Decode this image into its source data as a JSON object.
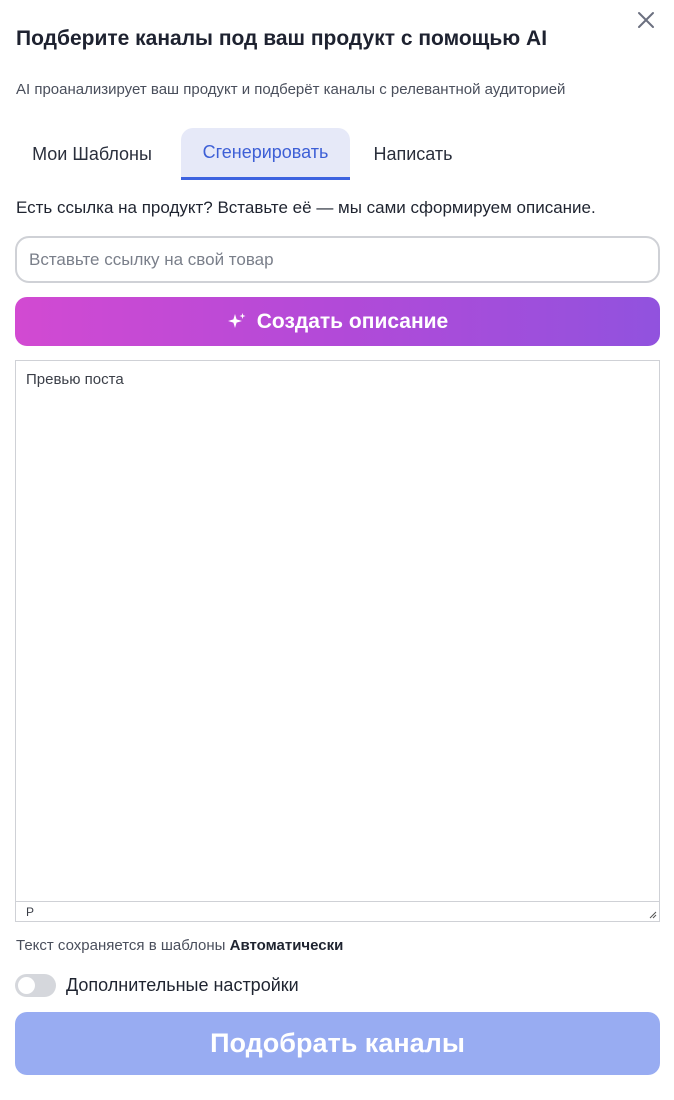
{
  "dialog": {
    "title": "Подберите каналы под ваш продукт с помощью AI",
    "subtitle": "AI проанализирует ваш продукт и подберёт каналы с релевантной аудиторией",
    "close_icon": "close-icon"
  },
  "tabs": [
    {
      "label": "Мои Шаблоны",
      "active": false
    },
    {
      "label": "Сгенерировать",
      "active": true
    },
    {
      "label": "Написать",
      "active": false
    }
  ],
  "generate": {
    "hint": "Есть ссылка на продукт? Вставьте её — мы сами сформируем описание.",
    "url_value": "",
    "url_placeholder": "Вставьте ссылку на свой товар",
    "button_label": "Создать описание",
    "button_icon": "sparkle-icon"
  },
  "editor": {
    "content": "Превью поста",
    "status_path": "P"
  },
  "save_note": {
    "text": "Текст сохраняется в шаблоны",
    "mode": "Автоматически"
  },
  "advanced_settings": {
    "label": "Дополнительные настройки",
    "enabled": false
  },
  "submit": {
    "label": "Подобрать каналы"
  },
  "colors": {
    "accent": "#3d63e0",
    "gradient_start": "#d24ad2",
    "gradient_end": "#9152de",
    "submit_disabled": "#98acf2"
  }
}
